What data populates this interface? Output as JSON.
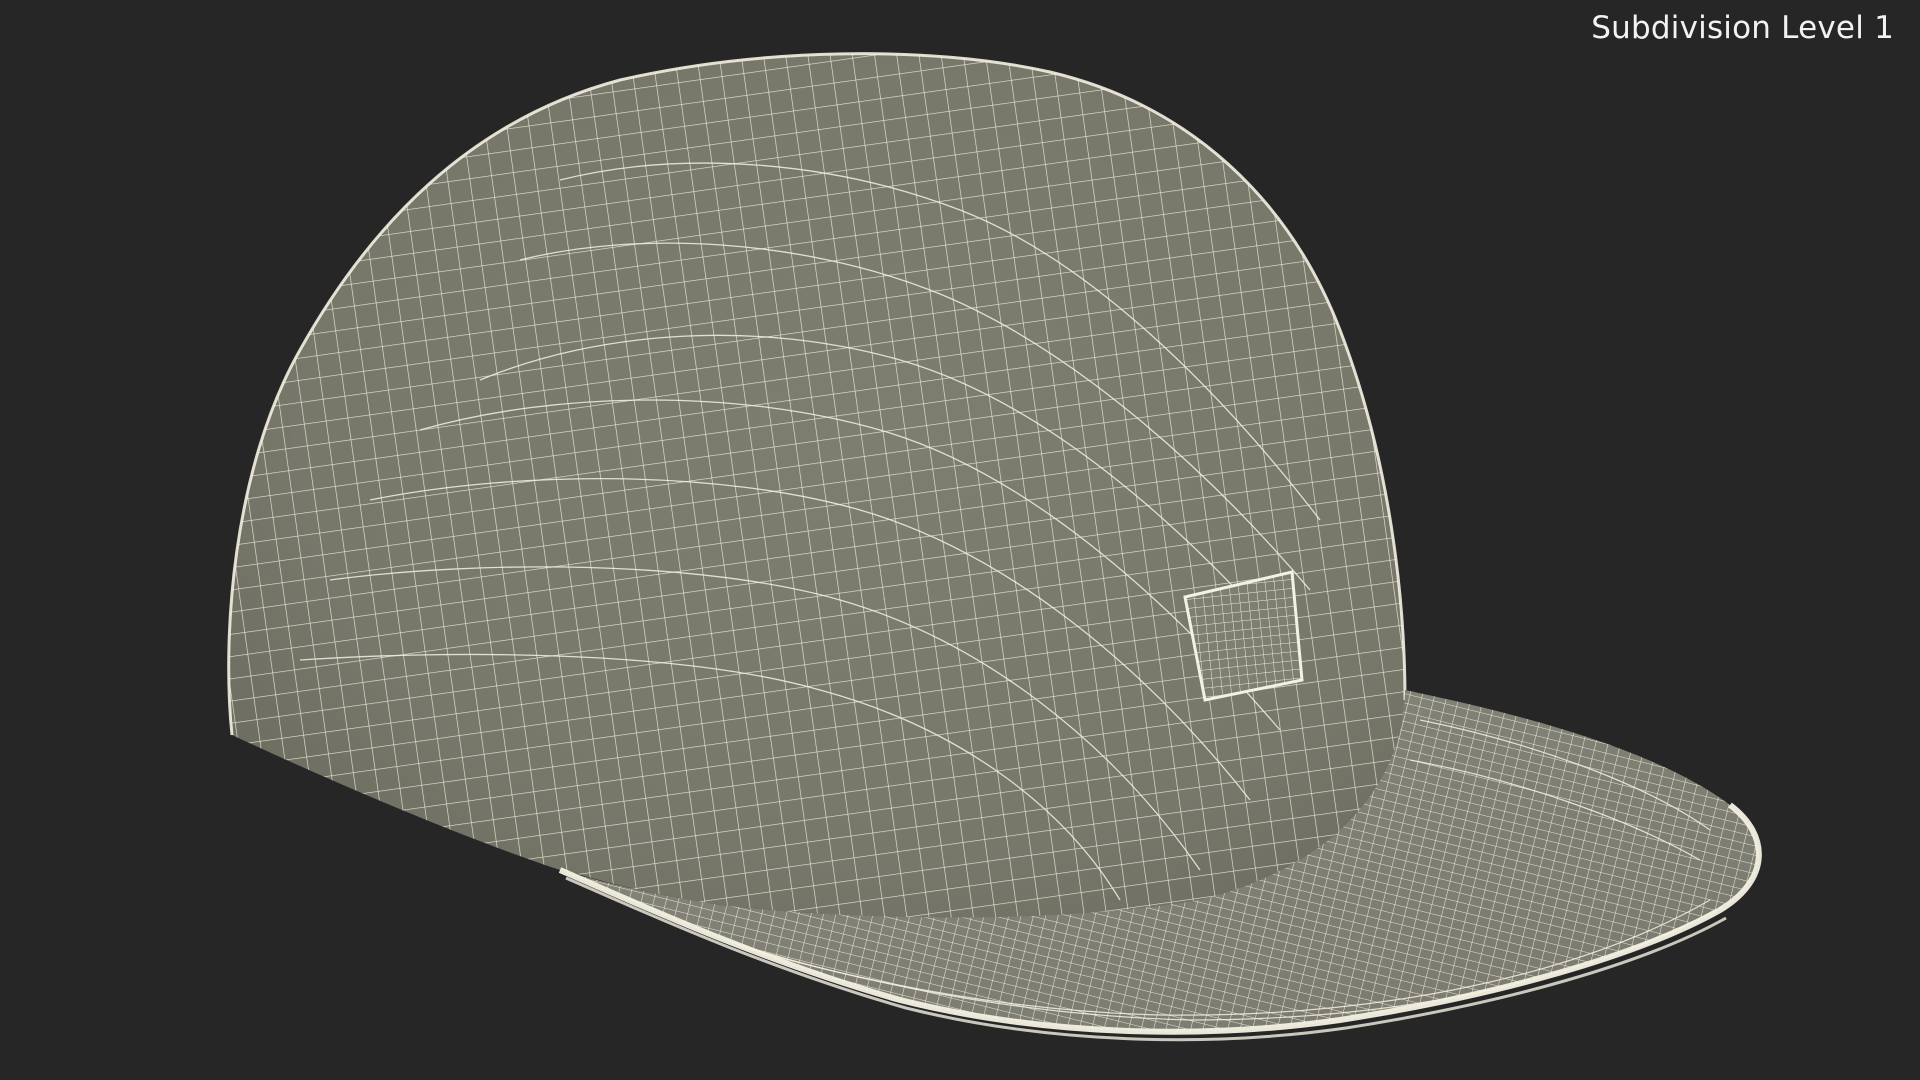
{
  "viewport": {
    "subdivision_label": "Subdivision Level 1",
    "background_color": "#262626"
  },
  "model": {
    "object": "cap-wireframe",
    "surface_color": "#7a7a6c",
    "wire_color": "#f4f1e2"
  }
}
